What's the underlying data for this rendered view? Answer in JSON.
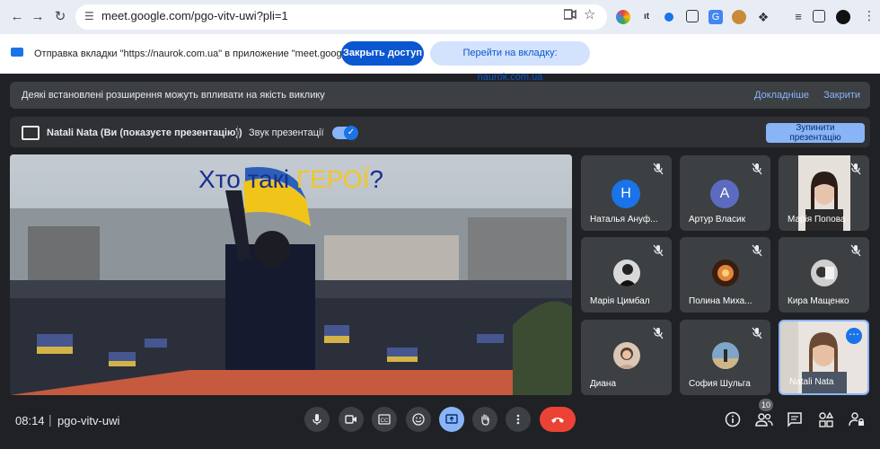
{
  "browser": {
    "url": "meet.google.com/pgo-vitv-uwi?pli=1"
  },
  "share_bar": {
    "message": "Отправка вкладки \"https://naurok.com.ua\" в приложение \"meet.google.com\"",
    "ellipsis": "...",
    "stop_label": "Закрыть доступ",
    "goto_label": "Перейти на вкладку: naurok.com.ua"
  },
  "notice": {
    "text": "Деякі встановлені розширення можуть впливати на якість виклику",
    "more_label": "Докладніше",
    "close_label": "Закрити"
  },
  "presentation_bar": {
    "presenter_label": "Natali Nata (Ви (показуєте презентацію))",
    "sound_label": "Звук презентації",
    "sound_on": true,
    "stop_label_line1": "Зупинити",
    "stop_label_line2": "презентацію"
  },
  "presentation": {
    "title_part1": "Хто такі ",
    "title_part2": "ГЕРОЇ",
    "title_part3": "?"
  },
  "participants": [
    {
      "name": "Наталья Ануф...",
      "initial": "Н",
      "avatar_color": "#1a73e8",
      "muted": true,
      "type": "initial"
    },
    {
      "name": "Артур Власик",
      "initial": "А",
      "avatar_color": "#5c6bc0",
      "muted": true,
      "type": "initial"
    },
    {
      "name": "Марія Попова",
      "muted": true,
      "type": "video"
    },
    {
      "name": "Марія Цимбал",
      "muted": true,
      "type": "photo"
    },
    {
      "name": "Полина Миха...",
      "muted": true,
      "type": "photo"
    },
    {
      "name": "Кира Мащенко",
      "muted": true,
      "type": "photo"
    },
    {
      "name": "Диана",
      "muted": true,
      "type": "photo"
    },
    {
      "name": "София Шульга",
      "muted": true,
      "type": "photo"
    },
    {
      "name": "Natali Nata",
      "muted": false,
      "type": "video",
      "speaking": true
    }
  ],
  "footer": {
    "time": "08:14",
    "meeting_code": "pgo-vitv-uwi",
    "people_count": "10"
  },
  "colors": {
    "accent": "#8ab4f8",
    "end_call": "#ea4335",
    "primary_button": "#0b57d0"
  }
}
